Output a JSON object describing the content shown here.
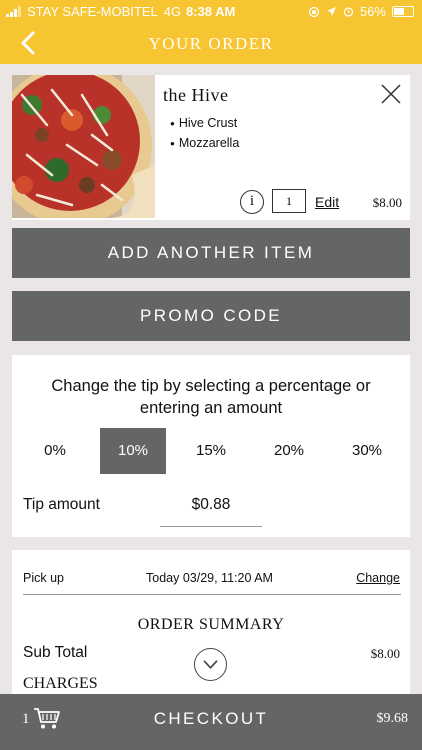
{
  "status_bar": {
    "carrier": "STAY SAFE-MOBITEL",
    "network": "4G",
    "time": "8:38 AM",
    "battery": "56%",
    "battery_level": 0.56
  },
  "header": {
    "title": "YOUR ORDER",
    "back_icon": "chevron-left-icon",
    "color": "#f7c531"
  },
  "item": {
    "name": "the Hive",
    "options": [
      "Hive Crust",
      "Mozzarella"
    ],
    "info_label": "i",
    "quantity": "1",
    "edit_label": "Edit",
    "price": "$8.00"
  },
  "buttons": {
    "add_item": "ADD ANOTHER ITEM",
    "promo": "PROMO CODE"
  },
  "tip": {
    "prompt": "Change the tip by selecting a percentage or entering an amount",
    "options": [
      "0%",
      "10%",
      "15%",
      "20%",
      "30%"
    ],
    "selected": "10%",
    "amount_label": "Tip amount",
    "amount_value": "$0.88"
  },
  "summary": {
    "pickup_label": "Pick up",
    "pickup_time": "Today 03/29, 11:20 AM",
    "change_label": "Change",
    "title": "ORDER SUMMARY",
    "subtotal_label": "Sub Total",
    "subtotal_value": "$8.00",
    "charges_label": "CHARGES"
  },
  "checkout": {
    "count": "1",
    "label": "CHECKOUT",
    "total": "$9.68"
  },
  "colors": {
    "accent": "#f7c531",
    "button": "#646664",
    "background": "#ebe6e6"
  }
}
